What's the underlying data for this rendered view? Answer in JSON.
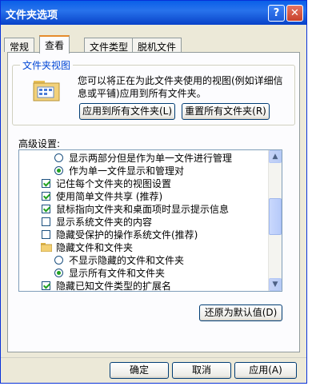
{
  "window": {
    "title": "文件夹选项"
  },
  "titlebar": {
    "help": "?",
    "close": "✕"
  },
  "tabs": [
    {
      "label": "常规"
    },
    {
      "label": "查看"
    },
    {
      "label": "文件类型"
    },
    {
      "label": "脱机文件"
    }
  ],
  "folder_view": {
    "group_label": "文件夹视图",
    "description": "您可以将正在为此文件夹使用的视图(例如详细信息或平铺)应用到所有文件夹。",
    "apply_all_label": "应用到所有文件夹(L)",
    "reset_all_label": "重置所有文件夹(R)"
  },
  "advanced": {
    "label": "高级设置:",
    "items": [
      {
        "type": "radio",
        "checked": false,
        "indent": 2,
        "label": "显示两部分但是作为单一文件进行管理"
      },
      {
        "type": "radio",
        "checked": true,
        "indent": 2,
        "label": "作为单一文件显示和管理对"
      },
      {
        "type": "checkbox",
        "checked": true,
        "indent": 1,
        "label": "记住每个文件夹的视图设置"
      },
      {
        "type": "checkbox",
        "checked": true,
        "indent": 1,
        "label": "使用简单文件共享 (推荐)"
      },
      {
        "type": "checkbox",
        "checked": true,
        "indent": 1,
        "label": "鼠标指向文件夹和桌面项时显示提示信息"
      },
      {
        "type": "checkbox",
        "checked": false,
        "indent": 1,
        "label": "显示系统文件夹的内容"
      },
      {
        "type": "checkbox",
        "checked": false,
        "indent": 1,
        "label": "隐藏受保护的操作系统文件(推荐)"
      },
      {
        "type": "folder",
        "checked": false,
        "indent": 1,
        "label": "隐藏文件和文件夹"
      },
      {
        "type": "radio",
        "checked": false,
        "indent": 2,
        "label": "不显示隐藏的文件和文件夹"
      },
      {
        "type": "radio",
        "checked": true,
        "indent": 2,
        "label": "显示所有文件和文件夹"
      },
      {
        "type": "checkbox",
        "checked": true,
        "indent": 1,
        "label": "隐藏已知文件类型的扩展名"
      }
    ],
    "restore_defaults_label": "还原为默认值(D)"
  },
  "footer": {
    "ok_label": "确定",
    "cancel_label": "取消",
    "apply_label": "应用(A)"
  },
  "colors": {
    "title_bar": "#0a5fe8",
    "group_label": "#0046d5",
    "check": "#21a121"
  }
}
